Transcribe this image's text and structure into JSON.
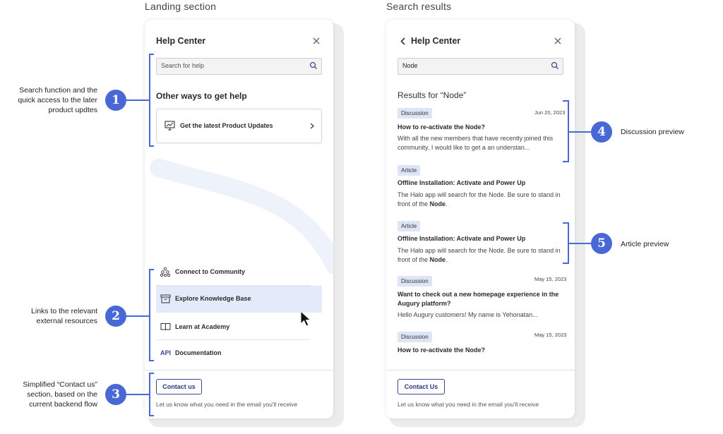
{
  "landing": {
    "section_title": "Landing section",
    "panel_title": "Help Center",
    "search_placeholder": "Search for help",
    "other_ways_title": "Other ways to get help",
    "product_updates_label": "Get the latest Product Updates",
    "links": [
      {
        "label": "Connect to Community",
        "icon": "community-icon"
      },
      {
        "label": "Explore Knowledge Base",
        "icon": "archive-box-icon"
      },
      {
        "label": "Learn at Academy",
        "icon": "book-icon"
      },
      {
        "label": "Documentation",
        "icon": "API"
      }
    ],
    "contact_button": "Contact us",
    "contact_text": "Let us know what you need in the email you'll receive"
  },
  "results": {
    "section_title": "Search  results",
    "panel_title": "Help Center",
    "search_value": "Node",
    "results_heading": "Results for “Node”",
    "items": [
      {
        "badge": "Discussion",
        "date": "Jun 20, 2023",
        "title": "How to re-activate the Node?",
        "snippet": "With all the new members that have recently joined this community, I would like to get a an understan...",
        "snippet_bold": ""
      },
      {
        "badge": "Article",
        "date": "",
        "title": "Offline Installation: Activate and Power Up",
        "snippet": "The Halo app will search for the Node. Be sure to stand in front of the",
        "snippet_bold": "Node"
      },
      {
        "badge": "Article",
        "date": "",
        "title": "Offline Installation: Activate and Power Up",
        "snippet": "The Halo app will search for the Node. Be sure to stand in front of the",
        "snippet_bold": "Node"
      },
      {
        "badge": "Discussion",
        "date": "May 15, 2023",
        "title": "Want to check out a new homepage experience in the Augury platform?",
        "snippet": "Hello Augury customers! My name is Yehonatan...",
        "snippet_bold": ""
      },
      {
        "badge": "Discussion",
        "date": "May 15, 2023",
        "title": "How to re-activate the Node?",
        "snippet": "",
        "snippet_bold": ""
      }
    ],
    "contact_button": "Contact Us",
    "contact_text": "Let us know what you need in the email you'll receive"
  },
  "annotations": [
    {
      "number": "1",
      "text": "Search function and the quick access to the later product updtes"
    },
    {
      "number": "2",
      "text": "Links to the relevant external resources"
    },
    {
      "number": "3",
      "text": "Simplified “Contact us” section, based on the current backend flow"
    },
    {
      "number": "4",
      "text": "Discussion preview"
    },
    {
      "number": "5",
      "text": "Article preview"
    }
  ],
  "colors": {
    "accent": "#4a67d6",
    "badge_bg": "#dde6f7",
    "highlight_row": "#e3ebfa",
    "button_border": "#3a4a8c"
  }
}
